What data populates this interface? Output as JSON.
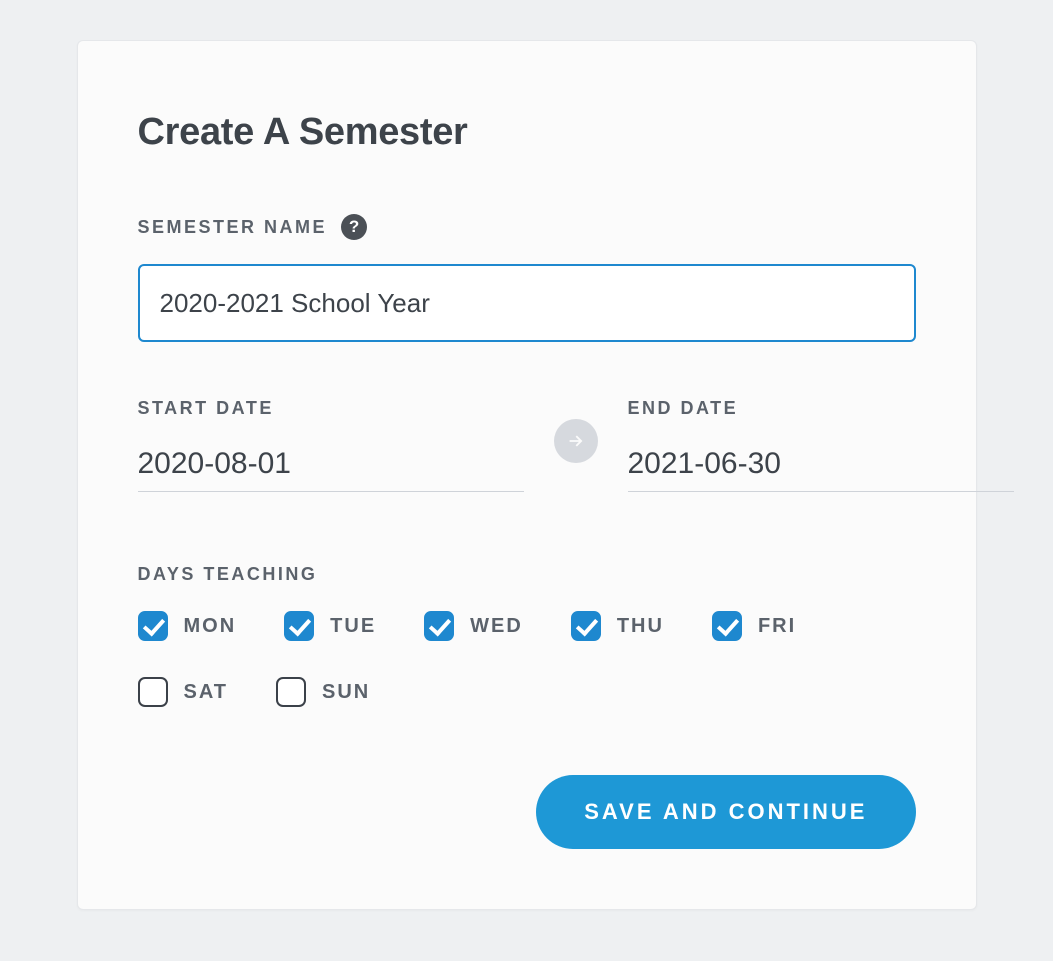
{
  "title": "Create A Semester",
  "semesterName": {
    "label": "SEMESTER NAME",
    "value": "2020-2021 School Year"
  },
  "startDate": {
    "label": "START DATE",
    "value": "2020-08-01"
  },
  "endDate": {
    "label": "END DATE",
    "value": "2021-06-30"
  },
  "daysTeaching": {
    "label": "DAYS TEACHING",
    "days": [
      {
        "label": "MON",
        "checked": true
      },
      {
        "label": "TUE",
        "checked": true
      },
      {
        "label": "WED",
        "checked": true
      },
      {
        "label": "THU",
        "checked": true
      },
      {
        "label": "FRI",
        "checked": true
      },
      {
        "label": "SAT",
        "checked": false
      },
      {
        "label": "SUN",
        "checked": false
      }
    ]
  },
  "actions": {
    "saveLabel": "SAVE AND CONTINUE"
  },
  "helpGlyph": "?"
}
